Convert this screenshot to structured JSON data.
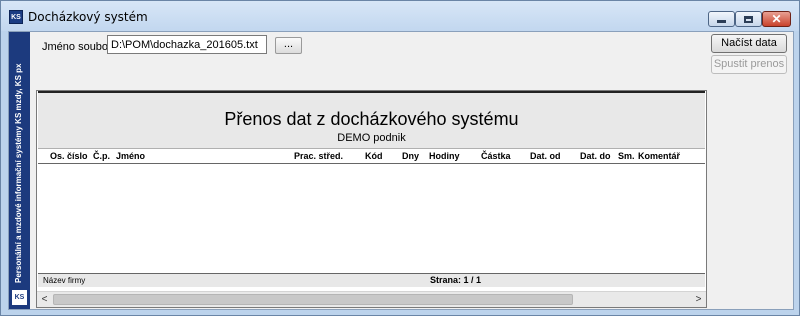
{
  "window": {
    "title": "Docházkový systém",
    "icon_text": "KS",
    "icons": {
      "minimize": "minimize-icon",
      "maximize": "maximize-icon",
      "close": "close-icon"
    },
    "close_glyph": "✕"
  },
  "sidebar": {
    "logo": "KS",
    "text": "Personální a mzdové informační systémy KS mzdy, KS px"
  },
  "form": {
    "file_label": "Jméno souboru:",
    "file_value": "D:\\POM\\dochazka_201605.txt",
    "browse_label": "...",
    "load_button": "Načíst data",
    "run_button": "Spustit prenos"
  },
  "report": {
    "title": "Přenos dat z docházkového systému",
    "company": "DEMO podnik",
    "columns": [
      "Os. číslo",
      "Č.p.",
      "Jméno",
      "Prac. střed.",
      "Kód",
      "Dny",
      "Hodiny",
      "Částka",
      "Dat. od",
      "Dat. do",
      "Sm.",
      "Komentář"
    ],
    "rows": [],
    "footer_left": "Název firmy",
    "footer_page": "Strana: 1 / 1"
  },
  "scrollbar": {
    "left_arrow": "<",
    "right_arrow": ">"
  },
  "colors": {
    "sidebar": "#1c3a7e",
    "close_button": "#c9422b",
    "window_frame": "#bcd3ec"
  }
}
